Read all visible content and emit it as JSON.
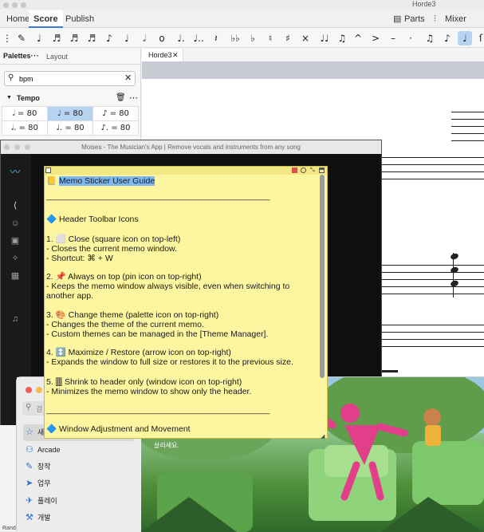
{
  "musescore": {
    "doc_title": "Horde3",
    "tabs": [
      "Home",
      "Score",
      "Publish"
    ],
    "parts_label": "Parts",
    "mixer_label": "Mixer",
    "palettes_tab": "Palettes",
    "layout_tab": "Layout",
    "search_value": "bpm",
    "tempo_section": "Tempo",
    "tempo_cells": [
      "𝅗𝅥 = 80",
      "♩ = 80",
      "♪ = 80",
      "𝅗𝅥. = 80",
      "♩. = 80",
      "♪. = 80"
    ],
    "score_tab": "Horde3"
  },
  "moises": {
    "title": "Moises - The Musician's App | Remove vocals and instruments from any song"
  },
  "memo": {
    "title": "Memo Sticker User Guide",
    "divider": "________________________________________________",
    "section1": "Header Toolbar Icons",
    "item1_title": "1. ⬜ Close (square icon on top-left)",
    "item1_a": "  - Closes the current memo window.",
    "item1_b": "  - Shortcut: ⌘ + W",
    "item2_title": "2. 📌 Always on top (pin icon on top-right)",
    "item2_a": "  - Keeps the memo window always visible, even when switching to",
    "item2_b": "another app.",
    "item3_title": "3. 🎨 Change theme (palette icon on top-right)",
    "item3_a": "  - Changes the theme of the current memo.",
    "item3_b": "  - Custom themes can be managed in the [Theme Manager].",
    "item4_title": "4. ↕️ Maximize / Restore (arrow icon on top-right)",
    "item4_a": "  - Expands the window to full size or restores it to the previous size.",
    "item5_title": "5. 🀫 Shrink to header only (window icon on top-right)",
    "item5_a": "  - Minimizes the memo window to show only the header.",
    "divider2": "________________________________________________",
    "section2": "Window Adjustment and Movement"
  },
  "appstore": {
    "search_placeholder": "검",
    "items": [
      "새",
      "Arcade",
      "창작",
      "업무",
      "플레이",
      "개발"
    ],
    "footer": "Rand",
    "hero_text": "살리세요."
  },
  "colors": {
    "memo_bg": "#fdf6a0",
    "accent": "#3b7bd5",
    "highlight": "#7fb8ef"
  }
}
